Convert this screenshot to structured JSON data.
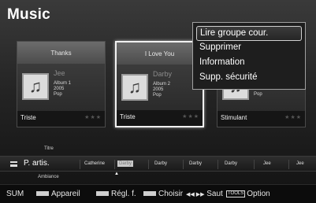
{
  "app": {
    "title": "Music"
  },
  "cards": [
    {
      "title": "Thanks",
      "artist": "Jee",
      "album": "Album 1",
      "year": "2005",
      "genre": "Pop",
      "mood": "Triste",
      "rating": "★★★"
    },
    {
      "title": "I Love You",
      "artist": "Darby",
      "album": "Album 2",
      "year": "2005",
      "genre": "Pop",
      "mood": "Triste",
      "rating": "★★★"
    },
    {
      "title": "",
      "artist": "",
      "album": "",
      "year": "2005",
      "genre": "Pop",
      "mood": "Stimulant",
      "rating": "★★★"
    }
  ],
  "context_menu": {
    "items": [
      {
        "label": "Lire groupe cour.",
        "active": true
      },
      {
        "label": "Supprimer"
      },
      {
        "label": "Information"
      },
      {
        "label": "Supp. sécurité"
      }
    ]
  },
  "sort_bar": {
    "prev_option": "Titre",
    "current": "P. artis.",
    "next_option": "Ambiance",
    "index": [
      "Catherine",
      "Darby",
      "Darby",
      "Darby",
      "Darby",
      "Jee",
      "Jee"
    ],
    "active_index": 1
  },
  "bottom_bar": {
    "source": "SUM",
    "device": "Appareil",
    "settings": "Régl. f.",
    "select": "Choisir",
    "jump": "Saut",
    "jump_arrows": "◀◀ ▶▶",
    "tools_key": "TOOLS",
    "option": "Option"
  },
  "colors": {
    "selected_border": "#f2f2f2",
    "menu_border": "#a0a0a0",
    "index_active": "#c9c9c9"
  },
  "icons": {
    "card_art": "music-note-icon",
    "sort": "list-sort-icon"
  }
}
